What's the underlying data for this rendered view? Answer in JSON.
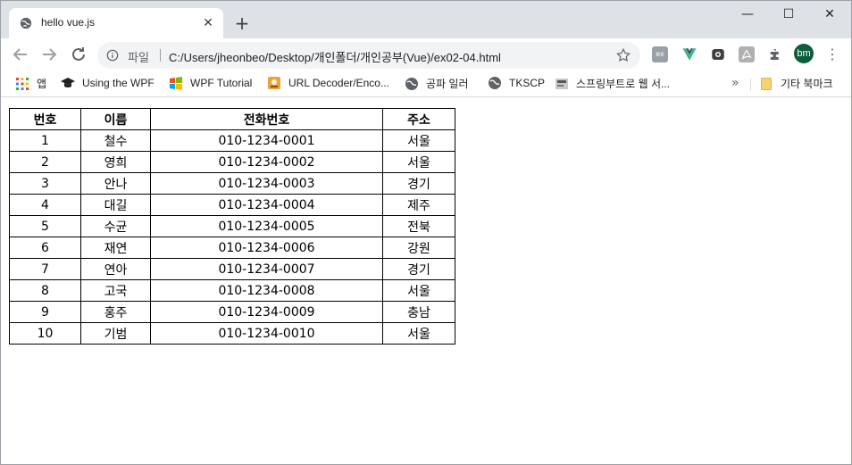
{
  "tab": {
    "title": "hello vue.js",
    "close": "✕"
  },
  "new_tab": "+",
  "window_controls": {
    "minimize": "—",
    "maximize": "☐",
    "close": "✕"
  },
  "omnibox": {
    "scheme_label": "파일",
    "url": "C:/Users/jheonbeo/Desktop/개인폴더/개인공부(Vue)/ex02-04.html"
  },
  "extensions": {
    "ext1_label": "ex"
  },
  "profile": {
    "initials": "bm",
    "color": "#0b5d3b"
  },
  "bookmarks": [
    {
      "label": "앱",
      "icon": "apps-grid-icon"
    },
    {
      "label": "Using the WPF",
      "icon": "graduation-cap-icon"
    },
    {
      "label": "WPF Tutorial",
      "icon": "windows-logo-icon"
    },
    {
      "label": "URL Decoder/Enco...",
      "icon": "site-favicon-icon"
    },
    {
      "label": "공파 일러",
      "icon": "globe-icon"
    },
    {
      "label": "TKSCP",
      "icon": "globe-icon"
    },
    {
      "label": "스프링부트로 웹 서...",
      "icon": "book-icon"
    }
  ],
  "bookmarks_more": "»",
  "other_bookmarks": "기타 북마크",
  "table": {
    "headers": [
      "번호",
      "이름",
      "전화번호",
      "주소"
    ],
    "rows": [
      [
        "1",
        "철수",
        "010-1234-0001",
        "서울"
      ],
      [
        "2",
        "영희",
        "010-1234-0002",
        "서울"
      ],
      [
        "3",
        "안나",
        "010-1234-0003",
        "경기"
      ],
      [
        "4",
        "대길",
        "010-1234-0004",
        "제주"
      ],
      [
        "5",
        "수균",
        "010-1234-0005",
        "전북"
      ],
      [
        "6",
        "재연",
        "010-1234-0006",
        "강원"
      ],
      [
        "7",
        "연아",
        "010-1234-0007",
        "경기"
      ],
      [
        "8",
        "고국",
        "010-1234-0008",
        "서울"
      ],
      [
        "9",
        "홍주",
        "010-1234-0009",
        "충남"
      ],
      [
        "10",
        "기범",
        "010-1234-0010",
        "서울"
      ]
    ]
  }
}
